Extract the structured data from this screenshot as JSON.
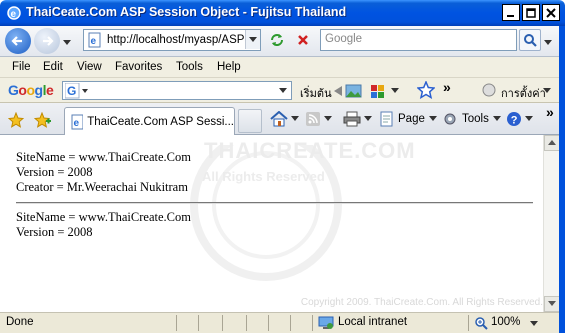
{
  "window": {
    "title": "ThaiCeate.Com ASP Session Object - Fujitsu Thailand",
    "minimize_label": "_",
    "close_label": "X"
  },
  "navigation": {
    "address": "http://localhost/myasp/ASPS",
    "search_placeholder": "Google"
  },
  "menu": {
    "items": [
      "File",
      "Edit",
      "View",
      "Favorites",
      "Tools",
      "Help"
    ]
  },
  "google_toolbar": {
    "logo": "Google",
    "search_label": "เริ่มต้น",
    "more_label": "»",
    "settings_label": "การตั้งค่า"
  },
  "tabs": {
    "active_tab_label": "ThaiCeate.Com ASP Sessi...",
    "page_label": "Page",
    "tools_label": "Tools",
    "more_label": "»"
  },
  "page": {
    "block1": [
      "SiteName = www.ThaiCreate.Com",
      "Version = 2008",
      "Creator = Mr.Weerachai Nukitram"
    ],
    "block2": [
      "SiteName = www.ThaiCreate.Com",
      "Version = 2008"
    ],
    "watermark_title": "THAICREATE.COM",
    "watermark_subtitle": "All Rights Reserved",
    "copyright": "Copyright 2009. ThaiCreate.Com. All Rights Reserved."
  },
  "status": {
    "text": "Done",
    "zone": "Local intranet",
    "zoom": "100%"
  },
  "colors": {
    "titlebar": "#0053e1",
    "chrome": "#ece9d8"
  }
}
